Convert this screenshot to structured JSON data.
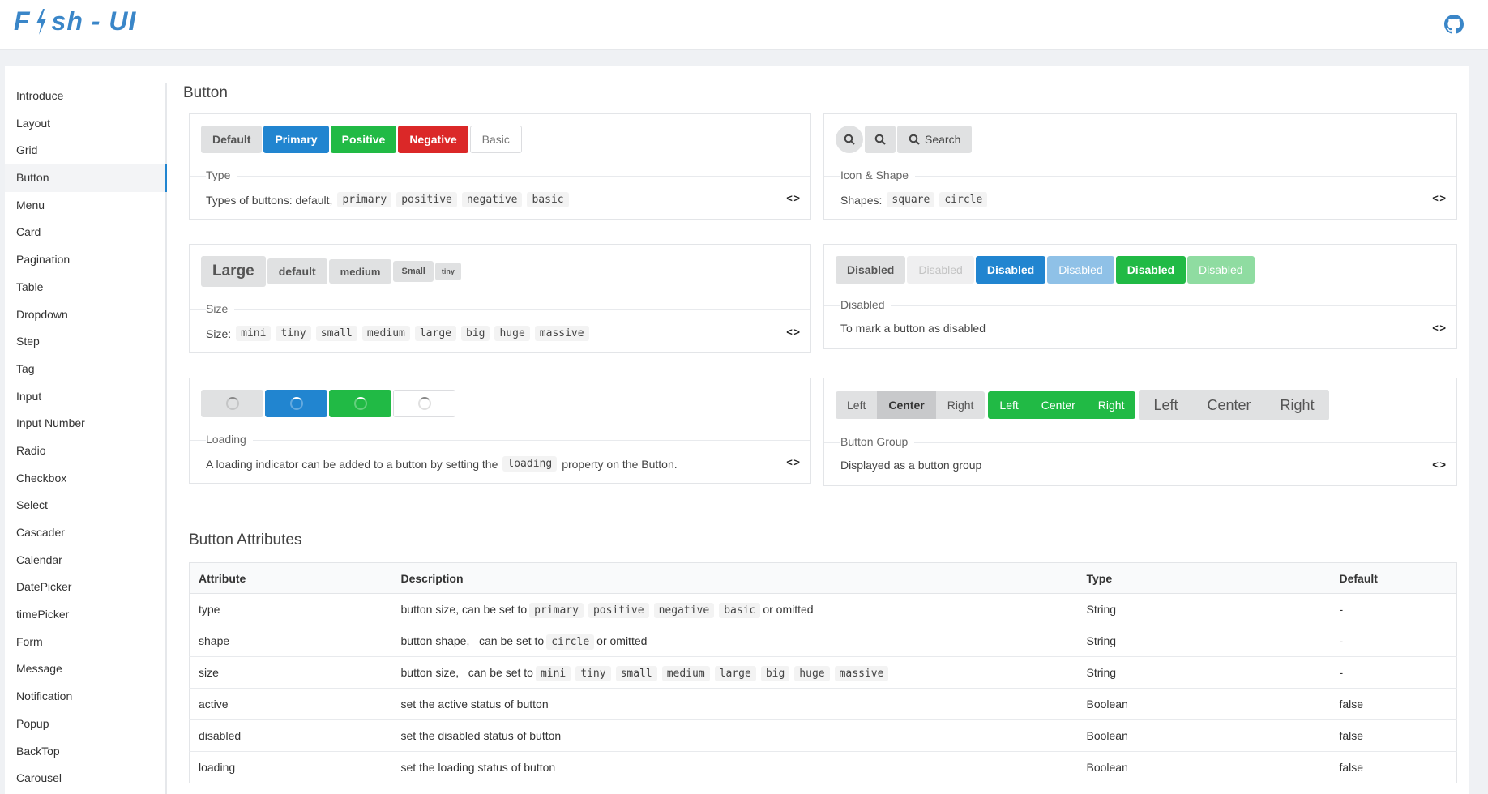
{
  "header": {
    "logo_left": "F",
    "logo_right": "sh - UI",
    "github_icon": "github-icon"
  },
  "sidebar": {
    "items": [
      "Introduce",
      "Layout",
      "Grid",
      "Button",
      "Menu",
      "Card",
      "Pagination",
      "Table",
      "Dropdown",
      "Step",
      "Tag",
      "Input",
      "Input Number",
      "Radio",
      "Checkbox",
      "Select",
      "Cascader",
      "Calendar",
      "DatePicker",
      "timePicker",
      "Form",
      "Message",
      "Notification",
      "Popup",
      "BackTop",
      "Carousel"
    ],
    "active": "Button"
  },
  "main": {
    "title": "Button",
    "type_demo": {
      "buttons": [
        "Default",
        "Primary",
        "Positive",
        "Negative",
        "Basic"
      ],
      "legend": "Type",
      "desc": "Types of buttons: default,",
      "codes": [
        "primary",
        "positive",
        "negative",
        "basic"
      ]
    },
    "icon_demo": {
      "search_label": "Search",
      "legend": "Icon & Shape",
      "desc": "Shapes:",
      "codes": [
        "square",
        "circle"
      ]
    },
    "size_demo": {
      "buttons": [
        "Large",
        "default",
        "medium",
        "Small",
        "tiny"
      ],
      "legend": "Size",
      "desc": "Size:",
      "codes": [
        "mini",
        "tiny",
        "small",
        "medium",
        "large",
        "big",
        "huge",
        "massive"
      ]
    },
    "disabled_demo": {
      "buttons": [
        "Disabled",
        "Disabled",
        "Disabled",
        "Disabled",
        "Disabled",
        "Disabled"
      ],
      "legend": "Disabled",
      "desc": "To mark a button as disabled"
    },
    "loading_demo": {
      "legend": "Loading",
      "desc_before": "A loading indicator can be added to a button by setting the",
      "code": "loading",
      "desc_after": "property on the Button."
    },
    "group_demo": {
      "group1": [
        "Left",
        "Center",
        "Right"
      ],
      "group2": [
        "Left",
        "Center",
        "Right"
      ],
      "group3": [
        "Left",
        "Center",
        "Right"
      ],
      "legend": "Button Group",
      "desc": "Displayed as a button group"
    },
    "code_toggle": "< >"
  },
  "attributes": {
    "title": "Button Attributes",
    "headers": [
      "Attribute",
      "Description",
      "Type",
      "Default"
    ],
    "rows": [
      {
        "attr": "type",
        "desc_before": "button size, can be set to",
        "codes": [
          "primary",
          "positive",
          "negative",
          "basic"
        ],
        "desc_after": "or omitted",
        "type": "String",
        "default": "-"
      },
      {
        "attr": "shape",
        "desc_before": "button shape,   can be set to",
        "codes": [
          "circle"
        ],
        "desc_after": "or omitted",
        "type": "String",
        "default": "-"
      },
      {
        "attr": "size",
        "desc_before": "button size,   can be set to",
        "codes": [
          "mini",
          "tiny",
          "small",
          "medium",
          "large",
          "big",
          "huge",
          "massive"
        ],
        "desc_after": "",
        "type": "String",
        "default": "-"
      },
      {
        "attr": "active",
        "desc_before": "set the active status of button",
        "codes": [],
        "desc_after": "",
        "type": "Boolean",
        "default": "false"
      },
      {
        "attr": "disabled",
        "desc_before": "set the disabled status of button",
        "codes": [],
        "desc_after": "",
        "type": "Boolean",
        "default": "false"
      },
      {
        "attr": "loading",
        "desc_before": "set the loading status of button",
        "codes": [],
        "desc_after": "",
        "type": "Boolean",
        "default": "false"
      }
    ]
  }
}
